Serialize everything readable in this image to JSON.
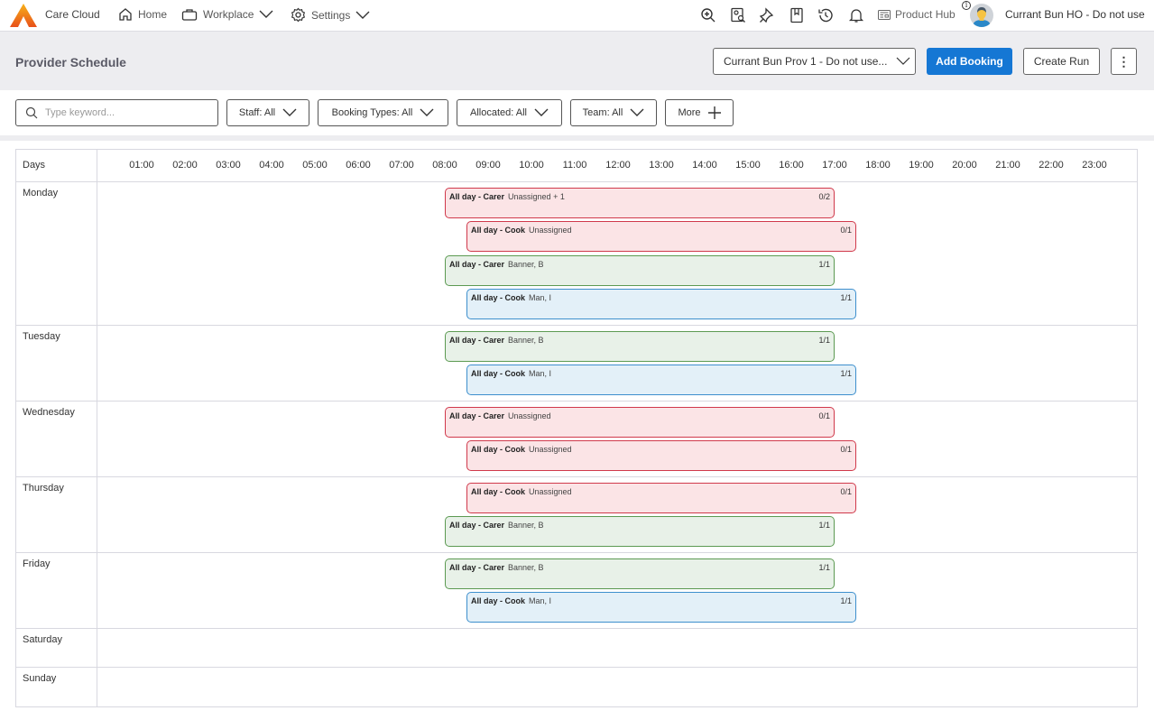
{
  "topbar": {
    "brand": "Care Cloud",
    "nav": [
      {
        "label": "Home",
        "icon": "home-icon",
        "dropdown": false
      },
      {
        "label": "Workplace",
        "icon": "briefcase-icon",
        "dropdown": true
      },
      {
        "label": "Settings",
        "icon": "gear-icon",
        "dropdown": true
      }
    ],
    "action_icons": [
      "zoom-in-icon",
      "search-profile-icon",
      "pin-icon",
      "bookmark-icon",
      "history-icon",
      "bell-icon"
    ],
    "product_hub": "Product Hub",
    "info_glyph": "i",
    "user_name": "Currant Bun HO - Do not use"
  },
  "header": {
    "title": "Provider Schedule",
    "provider_select": "Currant Bun Prov 1 - Do not use...",
    "add_booking": "Add Booking",
    "create_run": "Create Run",
    "more_glyph": "⋮"
  },
  "filters": {
    "search_placeholder": "Type keyword...",
    "items": [
      {
        "label": "Staff: All"
      },
      {
        "label": "Booking Types: All"
      },
      {
        "label": "Allocated: All"
      },
      {
        "label": "Team: All"
      },
      {
        "label": "More"
      }
    ]
  },
  "colors": {
    "primary": "#1577d4",
    "unassigned_bg": "#fbe4e6",
    "unassigned_border": "#d0394b",
    "carer_bg": "#e8f1e8",
    "carer_border": "#5c9a52",
    "cook_bg": "#e3f0f8",
    "cook_border": "#3d8fcd"
  },
  "schedule": {
    "days_label": "Days",
    "hours": [
      "01:00",
      "02:00",
      "03:00",
      "04:00",
      "05:00",
      "06:00",
      "07:00",
      "08:00",
      "09:00",
      "10:00",
      "11:00",
      "12:00",
      "13:00",
      "14:00",
      "15:00",
      "16:00",
      "17:00",
      "18:00",
      "19:00",
      "20:00",
      "21:00",
      "22:00",
      "23:00"
    ],
    "days": [
      {
        "name": "Monday",
        "bookings": [
          {
            "title": "All day - Carer",
            "who": "Unassigned + 1",
            "count": "0/2",
            "status": "unassigned",
            "start": 8,
            "end": 17
          },
          {
            "title": "All day - Cook",
            "who": "Unassigned",
            "count": "0/1",
            "status": "unassigned",
            "start": 8.5,
            "end": 17.5
          },
          {
            "title": "All day - Carer",
            "who": "Banner, B",
            "count": "1/1",
            "status": "carer-ok",
            "start": 8,
            "end": 17
          },
          {
            "title": "All day - Cook",
            "who": "Man, I",
            "count": "1/1",
            "status": "cook-ok",
            "start": 8.5,
            "end": 17.5
          }
        ]
      },
      {
        "name": "Tuesday",
        "bookings": [
          {
            "title": "All day - Carer",
            "who": "Banner, B",
            "count": "1/1",
            "status": "carer-ok",
            "start": 8,
            "end": 17
          },
          {
            "title": "All day - Cook",
            "who": "Man, I",
            "count": "1/1",
            "status": "cook-ok",
            "start": 8.5,
            "end": 17.5
          }
        ]
      },
      {
        "name": "Wednesday",
        "bookings": [
          {
            "title": "All day - Carer",
            "who": "Unassigned",
            "count": "0/1",
            "status": "unassigned",
            "start": 8,
            "end": 17
          },
          {
            "title": "All day - Cook",
            "who": "Unassigned",
            "count": "0/1",
            "status": "unassigned",
            "start": 8.5,
            "end": 17.5
          }
        ]
      },
      {
        "name": "Thursday",
        "bookings": [
          {
            "title": "All day - Cook",
            "who": "Unassigned",
            "count": "0/1",
            "status": "unassigned",
            "start": 8.5,
            "end": 17.5
          },
          {
            "title": "All day - Carer",
            "who": "Banner, B",
            "count": "1/1",
            "status": "carer-ok",
            "start": 8,
            "end": 17
          }
        ]
      },
      {
        "name": "Friday",
        "bookings": [
          {
            "title": "All day - Carer",
            "who": "Banner, B",
            "count": "1/1",
            "status": "carer-ok",
            "start": 8,
            "end": 17
          },
          {
            "title": "All day - Cook",
            "who": "Man, I",
            "count": "1/1",
            "status": "cook-ok",
            "start": 8.5,
            "end": 17.5
          }
        ]
      },
      {
        "name": "Saturday",
        "bookings": []
      },
      {
        "name": "Sunday",
        "bookings": []
      }
    ]
  }
}
